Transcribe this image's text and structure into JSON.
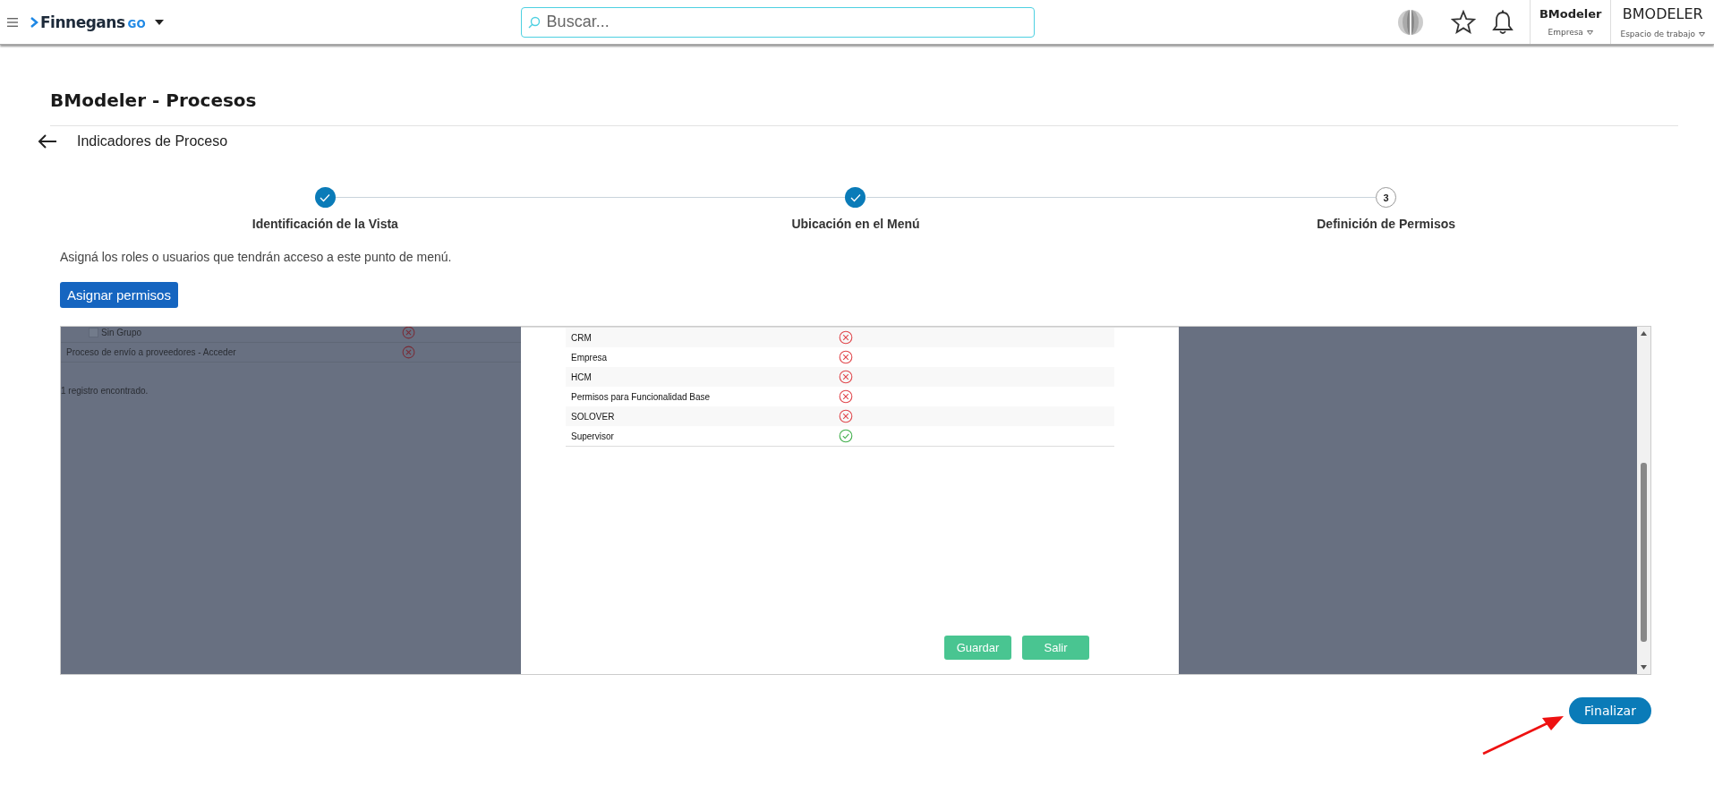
{
  "header": {
    "logo_text": "Finnegans",
    "logo_suffix": "GO",
    "search": {
      "placeholder": "Buscar..."
    },
    "company": {
      "name": "BModeler",
      "label": "Empresa"
    },
    "workspace": {
      "name": "BMODELER",
      "label": "Espacio de trabajo"
    }
  },
  "page": {
    "title": "BModeler - Procesos",
    "subtitle": "Indicadores de Proceso"
  },
  "steps": [
    {
      "label": "Identificación de la Vista",
      "done": true
    },
    {
      "label": "Ubicación en el Menú",
      "done": true
    },
    {
      "label": "Definición de Permisos",
      "number": "3",
      "done": false
    }
  ],
  "instructions": "Asigná los roles o usuarios que tendrán acceso a este punto de menú.",
  "assign_button": "Asignar permisos",
  "frame": {
    "background_rows": [
      {
        "kind": "group",
        "label": "Sin Grupo",
        "checked": false,
        "allowed": false
      },
      {
        "kind": "item",
        "label": "Proceso de envío a proveedores - Acceder",
        "allowed": false
      }
    ],
    "record_count": "1 registro encontrado.",
    "dialog": {
      "rows": [
        {
          "label": "CRM",
          "allowed": false
        },
        {
          "label": "Empresa",
          "allowed": false
        },
        {
          "label": "HCM",
          "allowed": false
        },
        {
          "label": "Permisos para Funcionalidad Base",
          "allowed": false
        },
        {
          "label": "SOLOVER",
          "allowed": false
        },
        {
          "label": "Supervisor",
          "allowed": true
        }
      ],
      "buttons": [
        "Guardar",
        "Salir"
      ]
    }
  },
  "finish_button": "Finalizar"
}
